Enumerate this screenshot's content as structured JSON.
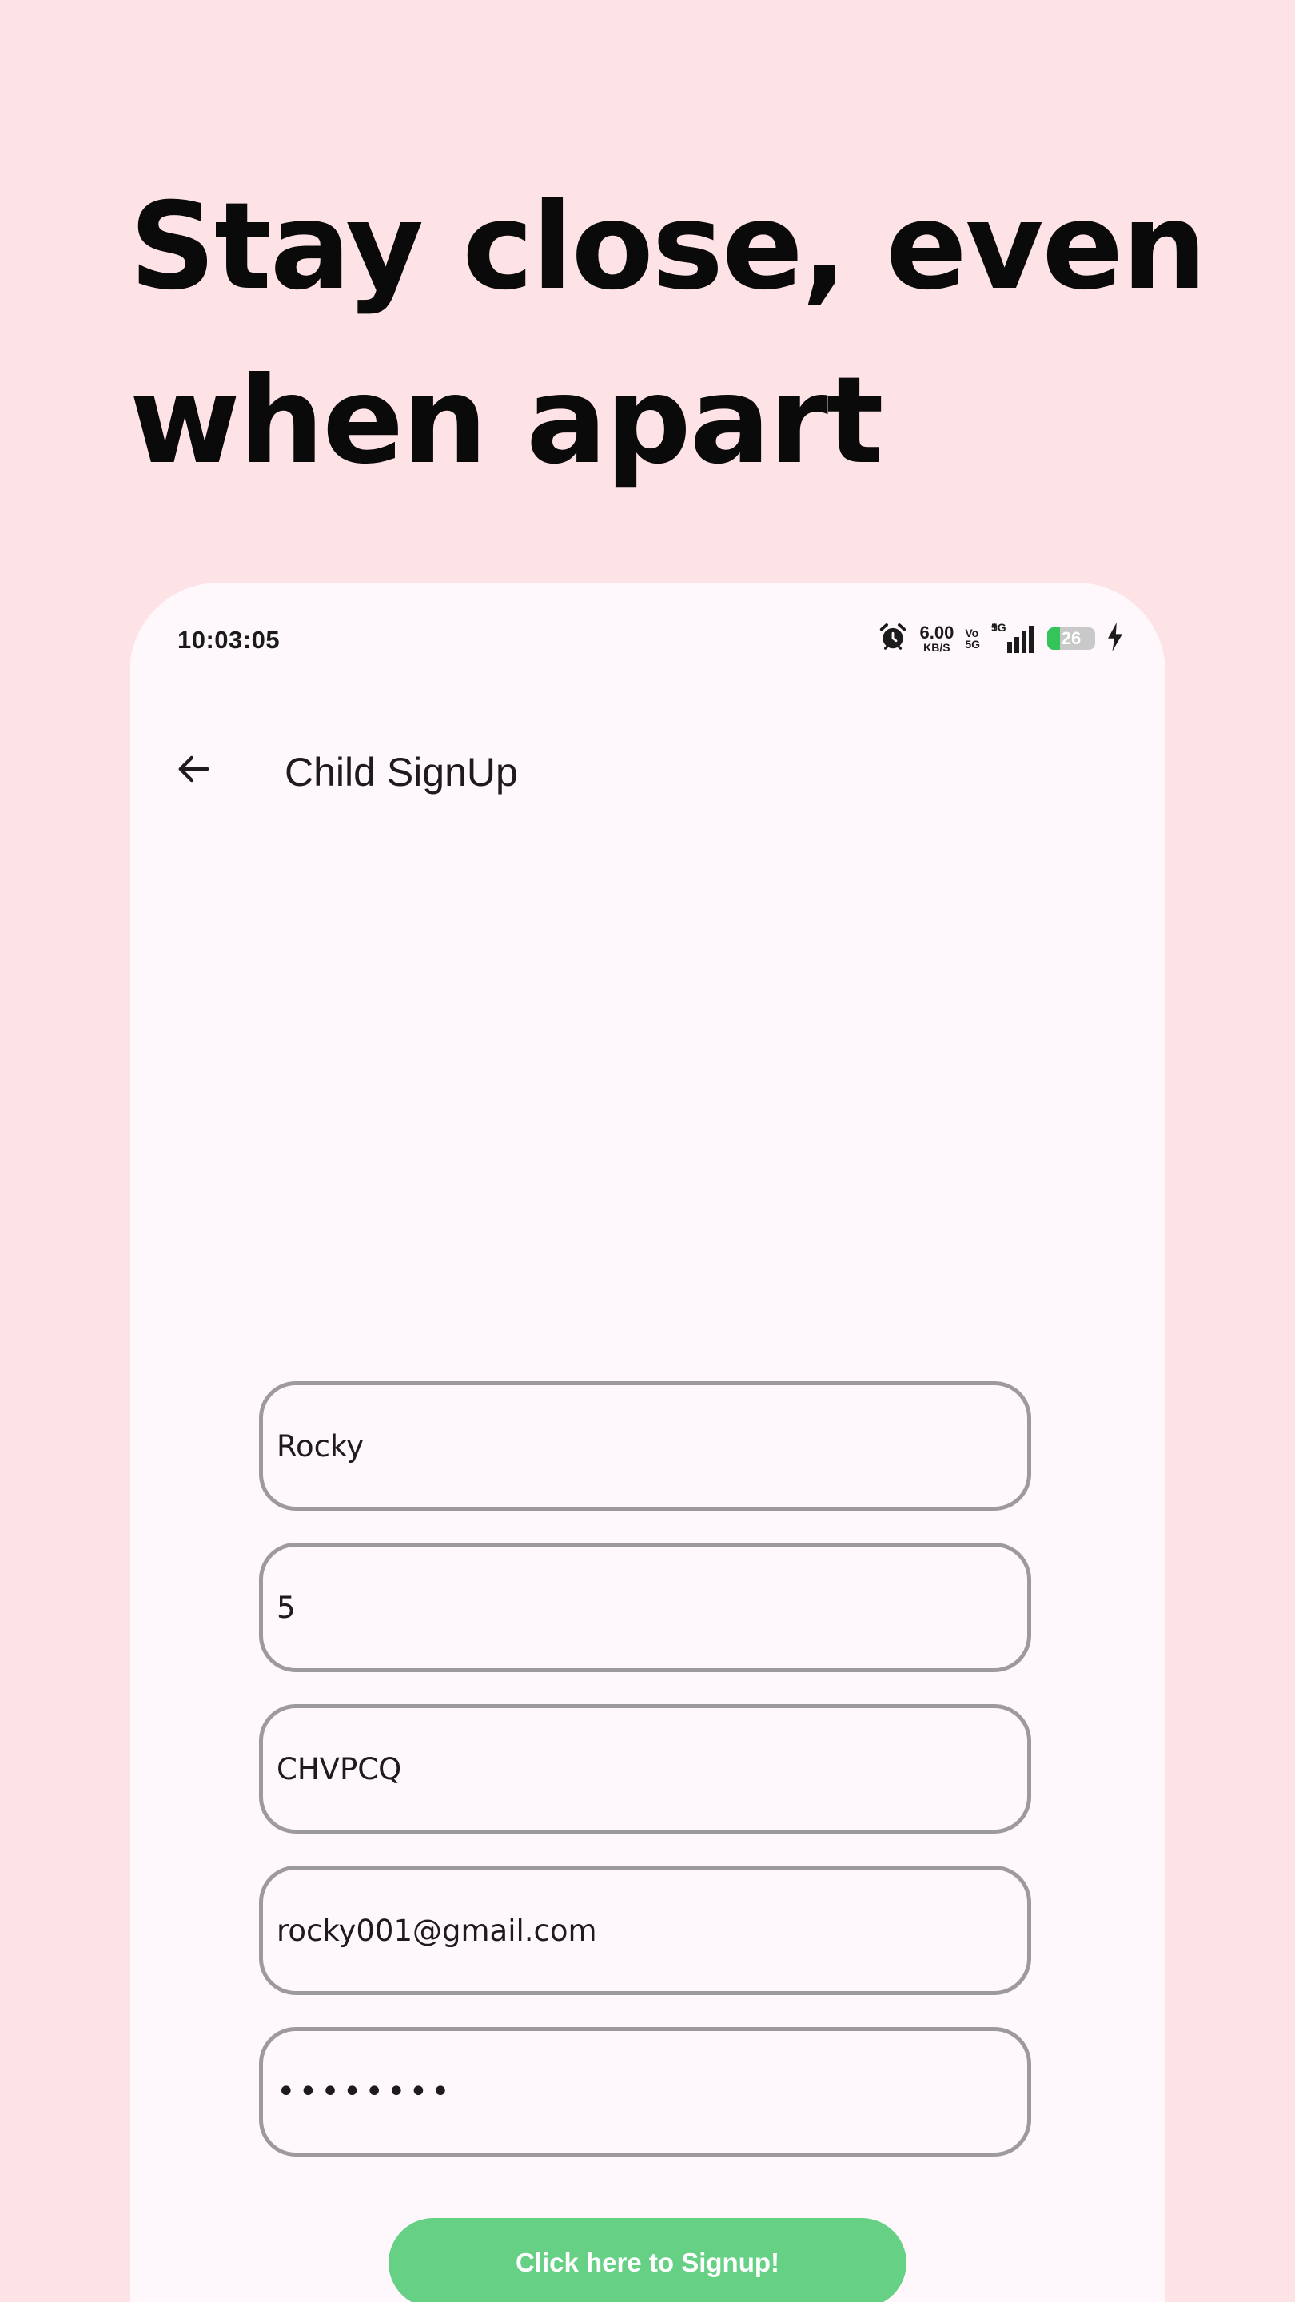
{
  "headline": {
    "line1": "Stay close, even",
    "line2": "when apart"
  },
  "status_bar": {
    "time": "10:03:05",
    "net_speed_value": "6.00",
    "net_speed_unit": "KB/S",
    "volte_top": "Vo",
    "volte_bottom": "5G",
    "network_type": "5G",
    "battery_level": "26",
    "icons": [
      "alarm-icon",
      "signal-icon",
      "battery-icon",
      "charging-icon"
    ]
  },
  "app_bar": {
    "title": "Child SignUp",
    "back_icon": "arrow-left-icon"
  },
  "form": {
    "name_value": "Rocky",
    "age_value": "5",
    "code_value": "CHVPCQ",
    "email_value": "rocky001@gmail.com",
    "password_value": "••••••••"
  },
  "signup_button": {
    "label": "Click here to Signup!"
  },
  "colors": {
    "page_background": "#FEE3E6",
    "screen_background": "#FEF7FC",
    "field_border": "#9C9A9F",
    "button_background": "#66D184",
    "battery_fill": "#34C55A"
  }
}
